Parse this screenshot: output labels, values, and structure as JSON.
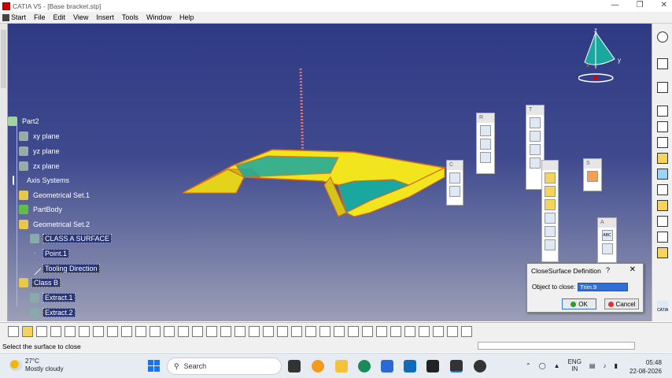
{
  "window": {
    "title": "CATIA V5 - [Base bracket.stp]",
    "controls": [
      "—",
      "❐",
      "✕"
    ]
  },
  "menu": {
    "start": "Start",
    "items": [
      "File",
      "Edit",
      "View",
      "Insert",
      "Tools",
      "Window",
      "Help"
    ]
  },
  "tree": {
    "nodes": [
      {
        "label": "Part2",
        "icon": "gear-icon"
      },
      {
        "label": "xy plane",
        "icon": "plane-icon"
      },
      {
        "label": "yz plane",
        "icon": "plane-icon"
      },
      {
        "label": "zx plane",
        "icon": "plane-icon"
      },
      {
        "label": "Axis Systems",
        "icon": "axis-icon"
      },
      {
        "label": "Geometrical Set.1",
        "icon": "geoset-icon"
      },
      {
        "label": "PartBody",
        "icon": "body-icon"
      },
      {
        "label": "Geometrical Set.2",
        "icon": "geoset-icon"
      },
      {
        "label": "CLASS A SURFACE",
        "icon": "surface-icon"
      },
      {
        "label": "Point.1",
        "icon": "point-icon"
      },
      {
        "label": "Tooling Direction",
        "icon": "line-icon"
      },
      {
        "label": "Class B",
        "icon": "geoset-icon"
      },
      {
        "label": "Extract.1",
        "icon": "extract-icon"
      },
      {
        "label": "Extract.2",
        "icon": "extract-icon"
      }
    ]
  },
  "palettes": {
    "r_label": "R",
    "t_label": "T",
    "s_label": "S",
    "a_label": "A",
    "c_label": "C",
    "a_text_icon": "ABC"
  },
  "compass": {
    "x": "x",
    "y": "y",
    "z": "z"
  },
  "dialog": {
    "title": "CloseSurface Definition",
    "help": "?",
    "close": "✕",
    "field_label": "Object to close:",
    "field_value": "Trim.9",
    "ok": "OK",
    "cancel": "Cancel"
  },
  "status": {
    "prompt": "Select the surface to close"
  },
  "taskbar": {
    "weather_temp": "27°C",
    "weather_desc": "Mostly cloudy",
    "search_placeholder": "Search",
    "lang_top": "ENG",
    "lang_bottom": "IN",
    "time": "05:48",
    "date": "22-08-2026"
  },
  "catia_logo_text": "CATIA",
  "colors": {
    "viewport_top": "#2e3a83",
    "viewport_bottom": "#9b9fb6",
    "part_yellow": "#f2e51d",
    "part_teal": "#1aa7a0",
    "part_edge": "#d86a18",
    "selection_blue": "#2f6fd6"
  }
}
